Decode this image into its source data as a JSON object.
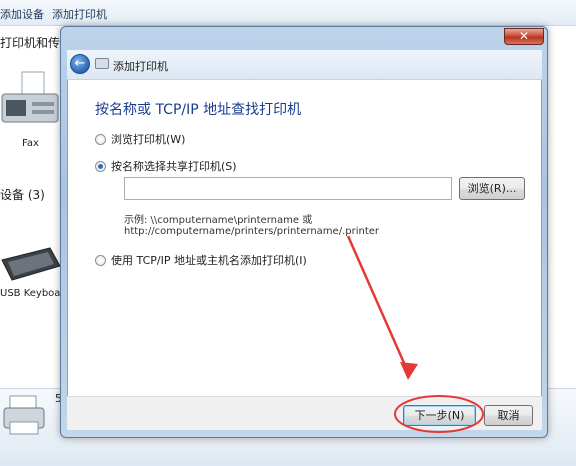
{
  "background": {
    "toolbar": {
      "add_device": "添加设备",
      "add_printer": "添加打印机"
    },
    "section_printers": "打印机和传真",
    "fax_label": "Fax",
    "section_devices": "设备 (3)",
    "keyboard_label": "USB Keyboard",
    "bottom_digit": "5"
  },
  "dialog": {
    "close_symbol": "✕",
    "back_symbol": "←",
    "nav_title": "添加打印机",
    "heading": "按名称或 TCP/IP 地址查找打印机",
    "option_browse": "浏览打印机(W)",
    "option_by_name": "按名称选择共享打印机(S)",
    "input_value": "",
    "browse_button": "浏览(R)...",
    "example_line1": "示例: \\\\computername\\printername 或",
    "example_line2": "http://computername/printers/printername/.printer",
    "option_tcpip": "使用 TCP/IP 地址或主机名添加打印机(I)",
    "next_button": "下一步(N)",
    "cancel_button": "取消"
  },
  "annotation": {
    "color": "#e53935"
  }
}
